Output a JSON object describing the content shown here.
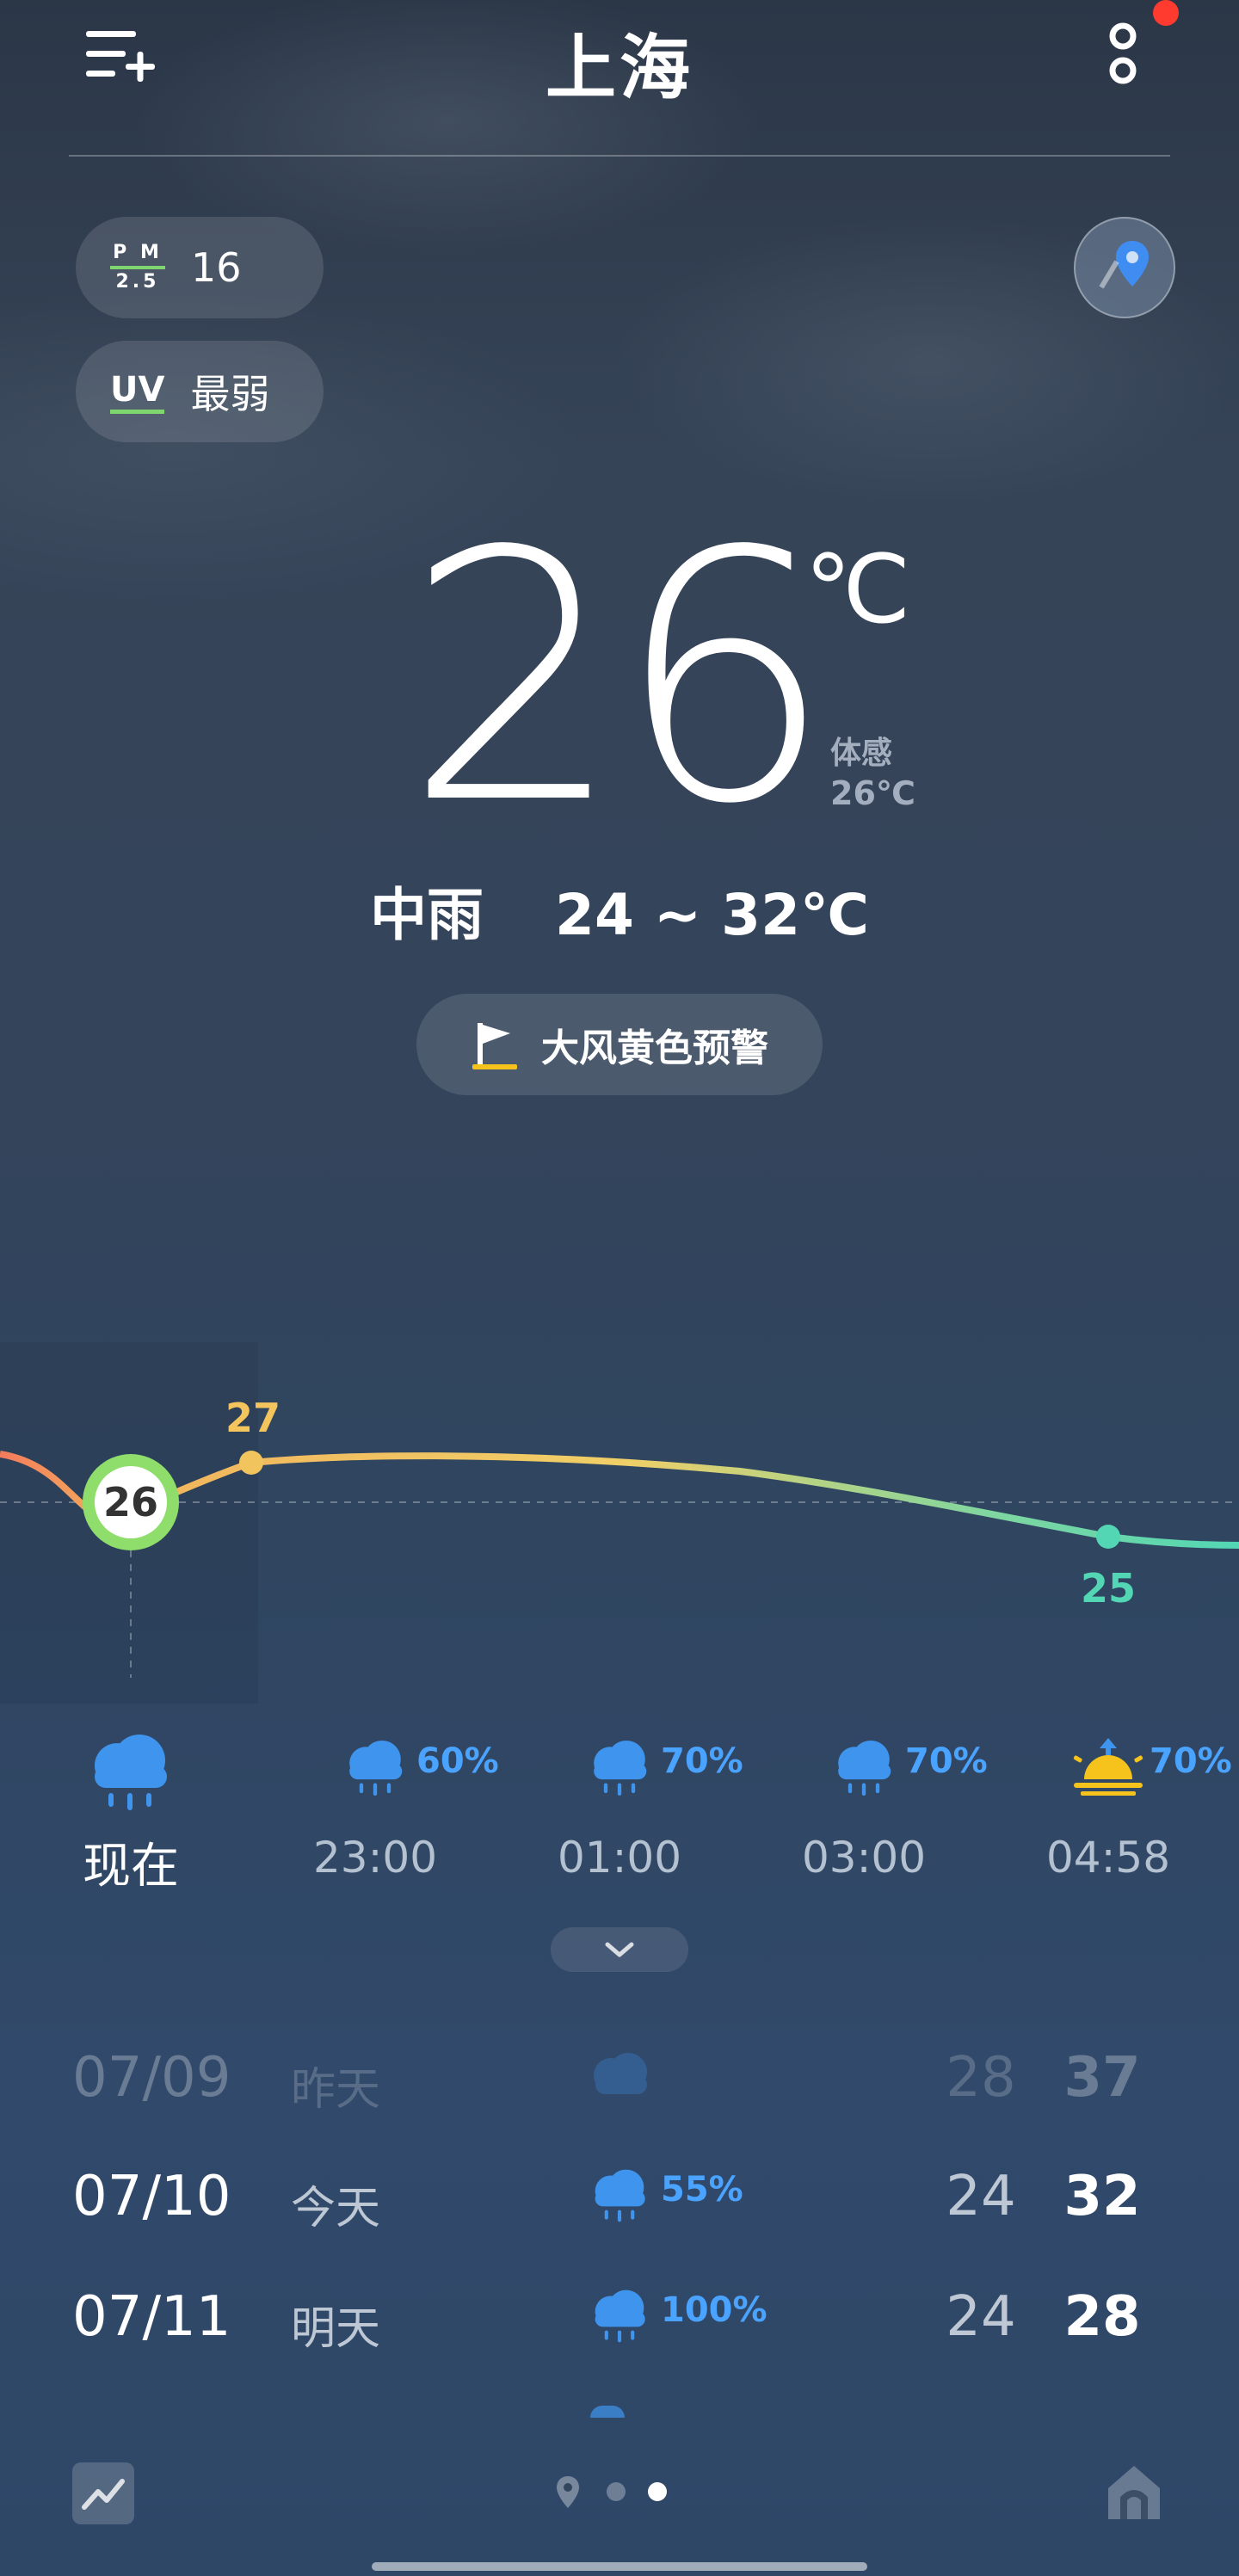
{
  "header": {
    "city": "上海"
  },
  "air": {
    "pm_label_top": "P M",
    "pm_label_bottom": "2.5",
    "pm_value": "16",
    "uv_label": "UV",
    "uv_value": "最弱"
  },
  "current": {
    "temp": "26",
    "unit": "℃",
    "feels_label": "体感",
    "feels_value": "26℃",
    "condition": "中雨",
    "range": "24 ~ 32℃"
  },
  "alert": {
    "text": "大风黄色预警"
  },
  "hourly_chart": {
    "now_temp": "26",
    "high_label": "27",
    "low_label": "25"
  },
  "hourly": [
    {
      "time": "现在",
      "precip": "",
      "icon": "rain-cloud-icon"
    },
    {
      "time": "23:00",
      "precip": "60%",
      "icon": "rain-cloud-icon"
    },
    {
      "time": "01:00",
      "precip": "70%",
      "icon": "rain-cloud-icon"
    },
    {
      "time": "03:00",
      "precip": "70%",
      "icon": "rain-cloud-icon"
    },
    {
      "time": "04:58",
      "precip": "70%",
      "icon": "sunrise-icon"
    }
  ],
  "daily": [
    {
      "date": "07/09",
      "name": "昨天",
      "pct": "",
      "low": "28",
      "high": "37",
      "icon": "cloud-icon"
    },
    {
      "date": "07/10",
      "name": "今天",
      "pct": "55%",
      "low": "24",
      "high": "32",
      "icon": "rain-cloud-icon"
    },
    {
      "date": "07/11",
      "name": "明天",
      "pct": "100%",
      "low": "24",
      "high": "28",
      "icon": "rain-cloud-icon"
    }
  ],
  "colors": {
    "accent_green": "#7fd66e",
    "precip_blue": "#4aa3ff",
    "warm": "#f4c55c",
    "cool": "#52d6b4",
    "alert_yellow": "#f6c31c"
  }
}
